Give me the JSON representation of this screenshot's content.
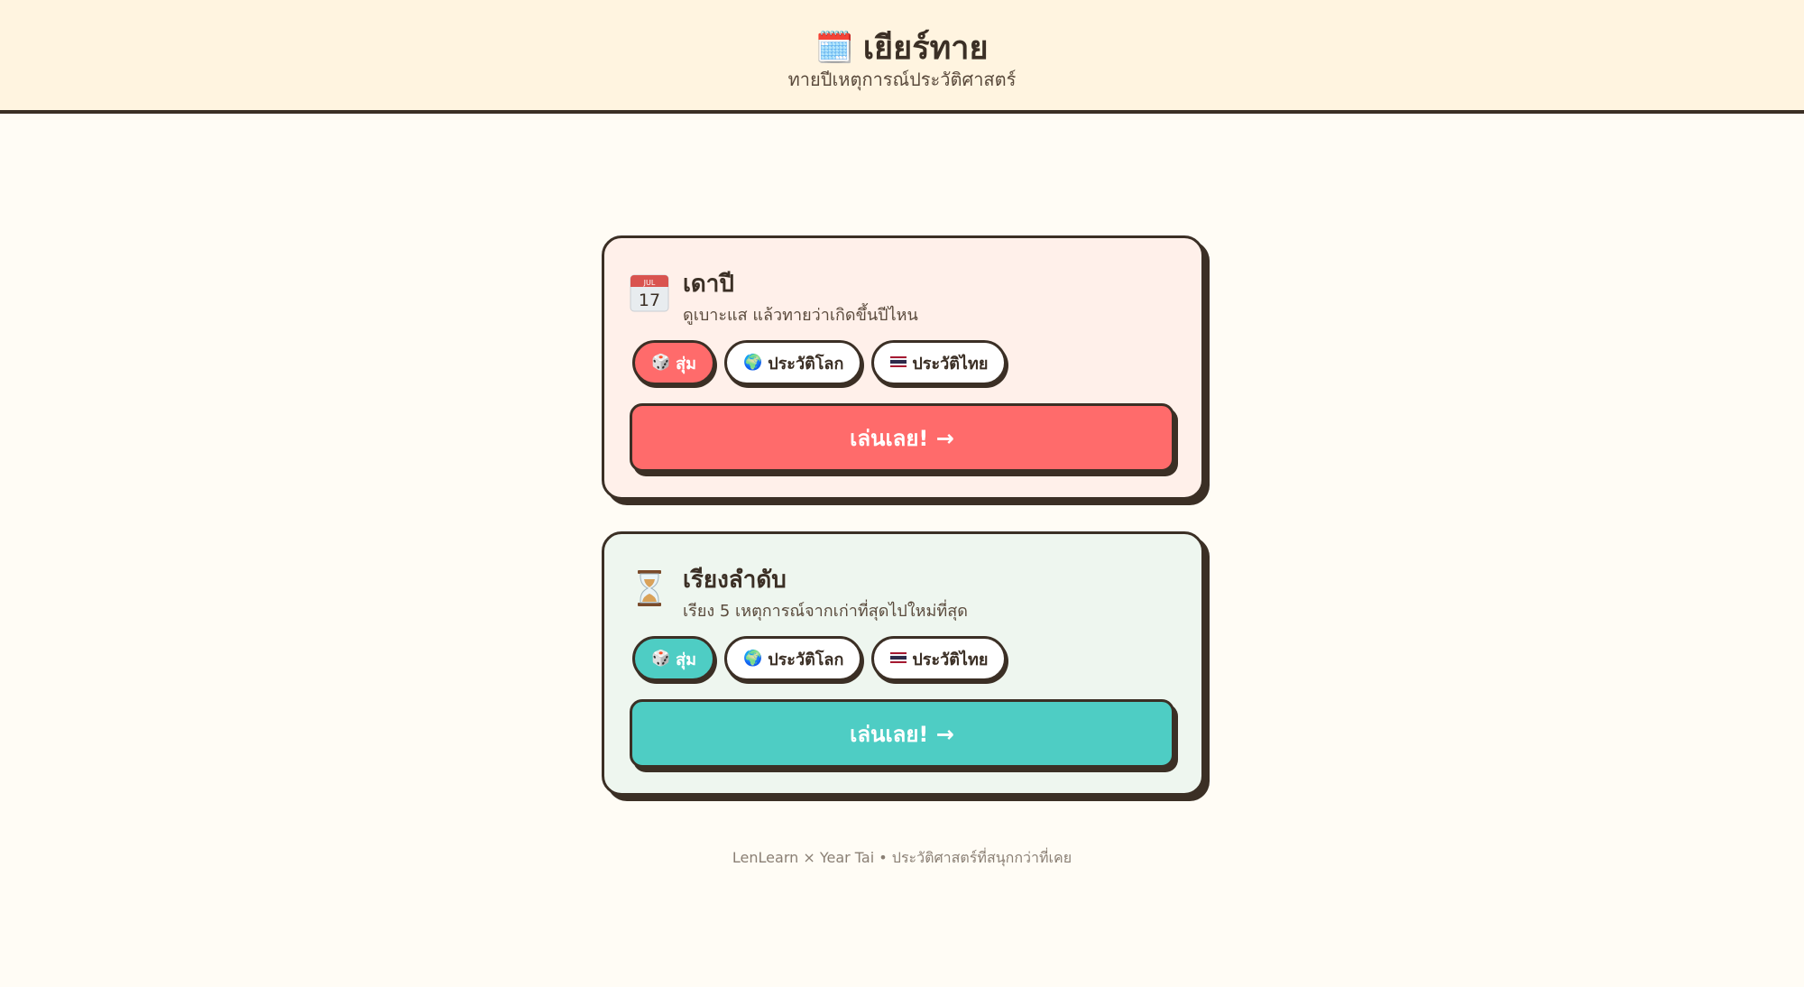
{
  "header": {
    "icon": "calendar-notepad-icon",
    "title": "เยียร์ทาย",
    "subtitle": "ทายปีเหตุการณ์ประวัติศาสตร์"
  },
  "modes": [
    {
      "icon": "calendar-icon",
      "calendar_month": "JUL",
      "calendar_day": "17",
      "title": "เดาปี",
      "description": "ดูเบาะแส แล้วทายว่าเกิดขึ้นปีไหน",
      "categories": [
        {
          "icon": "dice-icon",
          "label": "สุ่ม",
          "selected": true
        },
        {
          "icon": "globe-icon",
          "label": "ประวัติโลก",
          "selected": false
        },
        {
          "icon": "thai-flag-icon",
          "label": "ประวัติไทย",
          "selected": false
        }
      ],
      "play_label": "เล่นเลย! →",
      "accent_color": "#ff6b6b",
      "background_color": "#fff0ea"
    },
    {
      "icon": "hourglass-icon",
      "title": "เรียงลำดับ",
      "description": "เรียง 5 เหตุการณ์จากเก่าที่สุดไปใหม่ที่สุด",
      "categories": [
        {
          "icon": "dice-icon",
          "label": "สุ่ม",
          "selected": true
        },
        {
          "icon": "globe-icon",
          "label": "ประวัติโลก",
          "selected": false
        },
        {
          "icon": "thai-flag-icon",
          "label": "ประวัติไทย",
          "selected": false
        }
      ],
      "play_label": "เล่นเลย! →",
      "accent_color": "#4ecdc4",
      "background_color": "#eef6ef"
    }
  ],
  "footer": {
    "text": "LenLearn × Year Tai • ประวัติศาสตร์ที่สนุกกว่าที่เคย"
  }
}
